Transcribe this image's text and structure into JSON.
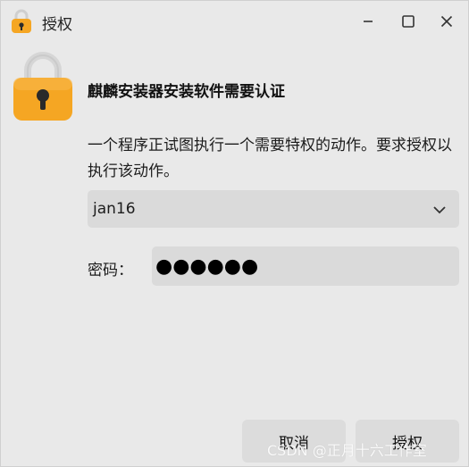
{
  "window": {
    "title": "授权",
    "title_icon": "lock-icon",
    "controls": {
      "minimize": "minimize-icon",
      "maximize": "maximize-icon",
      "close": "close-icon"
    }
  },
  "dialog": {
    "icon": "lock-icon",
    "heading": "麒麟安装器安装软件需要认证",
    "message": "一个程序正试图执行一个需要特权的动作。要求授权以执行该动作。",
    "user_select": {
      "value": "jan16",
      "icon": "chevron-down-icon"
    },
    "password": {
      "label": "密码：",
      "value": "●●●●●●"
    },
    "buttons": {
      "cancel": "取消",
      "authorize": "授权"
    }
  },
  "watermark": "CSDN @正月十六工作室",
  "colors": {
    "background": "#e9e9e9",
    "field": "#dadada",
    "lock_body": "#f5a623",
    "lock_shackle": "#d9d9d9"
  }
}
